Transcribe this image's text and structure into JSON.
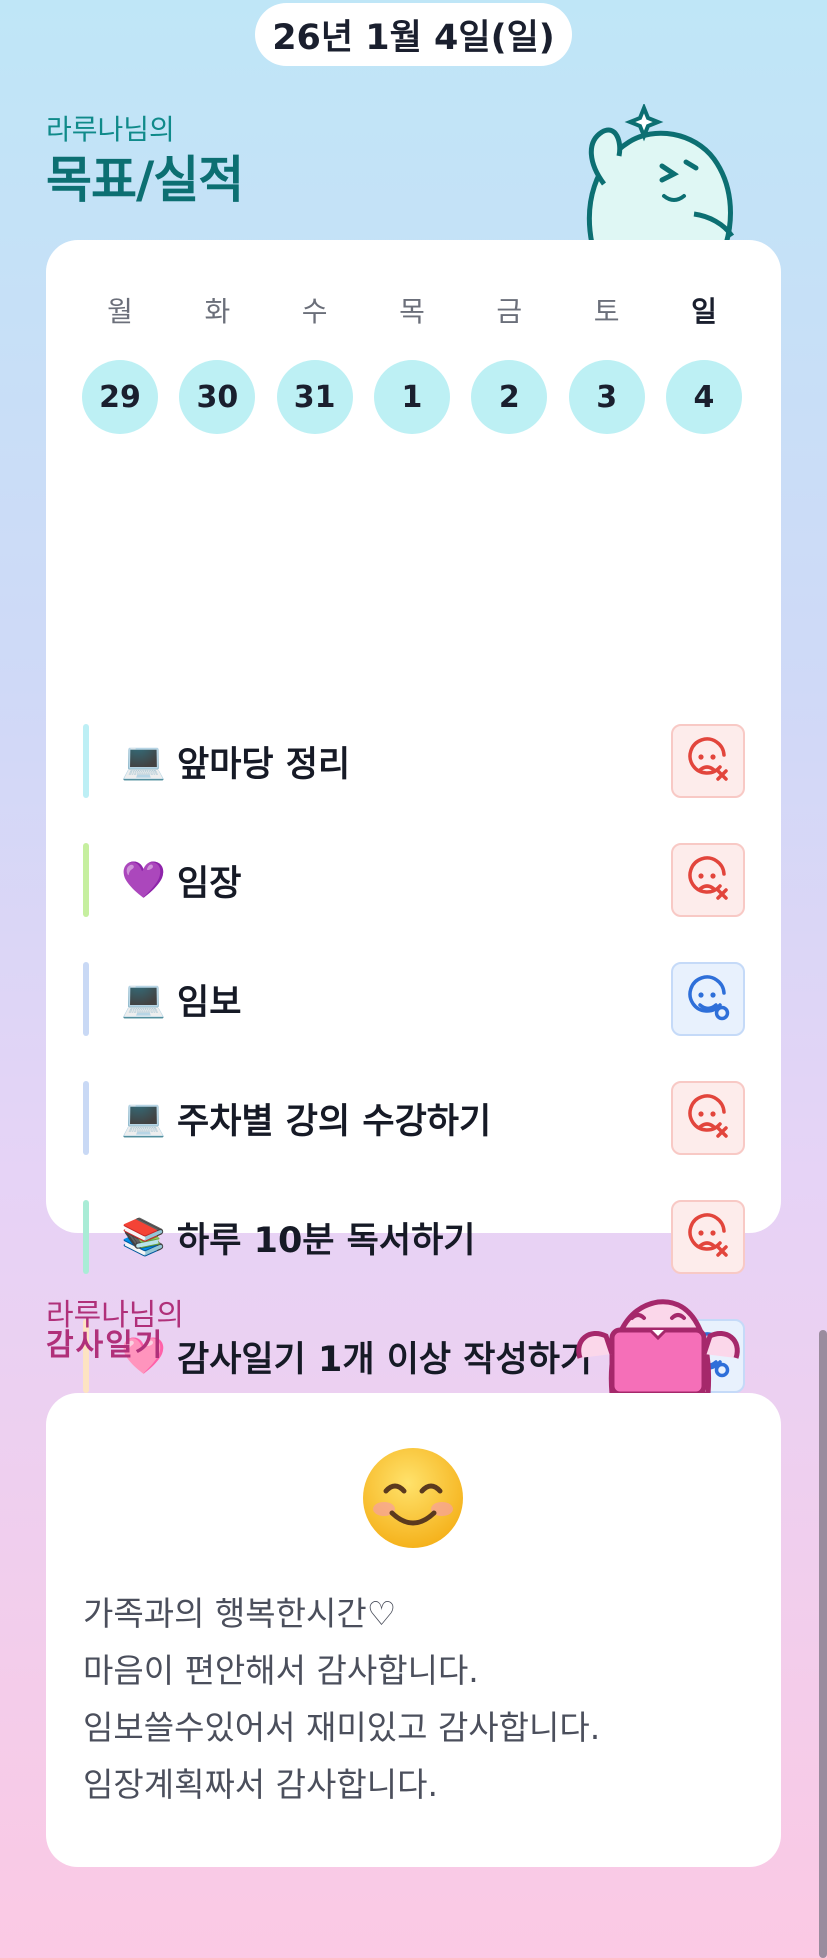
{
  "header": {
    "date": "26년 1월 4일(일)"
  },
  "goals_section": {
    "subtitle": "라루나님의",
    "title": "목표/실적",
    "weekdays": [
      "월",
      "화",
      "수",
      "목",
      "금",
      "토",
      "일"
    ],
    "active_weekday_index": 6,
    "days": [
      "29",
      "30",
      "31",
      "1",
      "2",
      "3",
      "4"
    ],
    "goals": [
      {
        "emoji": "💻",
        "label": "앞마당 정리",
        "status": "fail",
        "bar_color": "#bdeff5"
      },
      {
        "emoji": "💜",
        "label": "임장",
        "status": "fail",
        "bar_color": "#c6ef9f"
      },
      {
        "emoji": "💻",
        "label": "임보",
        "status": "done",
        "bar_color": "#c9d9f5"
      },
      {
        "emoji": "💻",
        "label": "주차별 강의 수강하기",
        "status": "fail",
        "bar_color": "#c9d9f5"
      },
      {
        "emoji": "📚",
        "label": "하루 10분 독서하기",
        "status": "fail",
        "bar_color": "#a9ecd6"
      },
      {
        "emoji": "🩷",
        "label": "감사일기 1개 이상 작성하기",
        "status": "done",
        "bar_color": "#fde3c2"
      }
    ],
    "status_colors": {
      "fail": "#e2453c",
      "done": "#2e6fd9"
    }
  },
  "gratitude_section": {
    "subtitle": "라루나님의",
    "title": "감사일기",
    "mood_icon": "smiling-face-icon",
    "lines": [
      "가족과의 행복한시간♡",
      "마음이 편안해서 감사합니다.",
      "임보쓸수있어서 재미있고 감사합니다.",
      "임장계획짜서 감사합니다."
    ]
  }
}
